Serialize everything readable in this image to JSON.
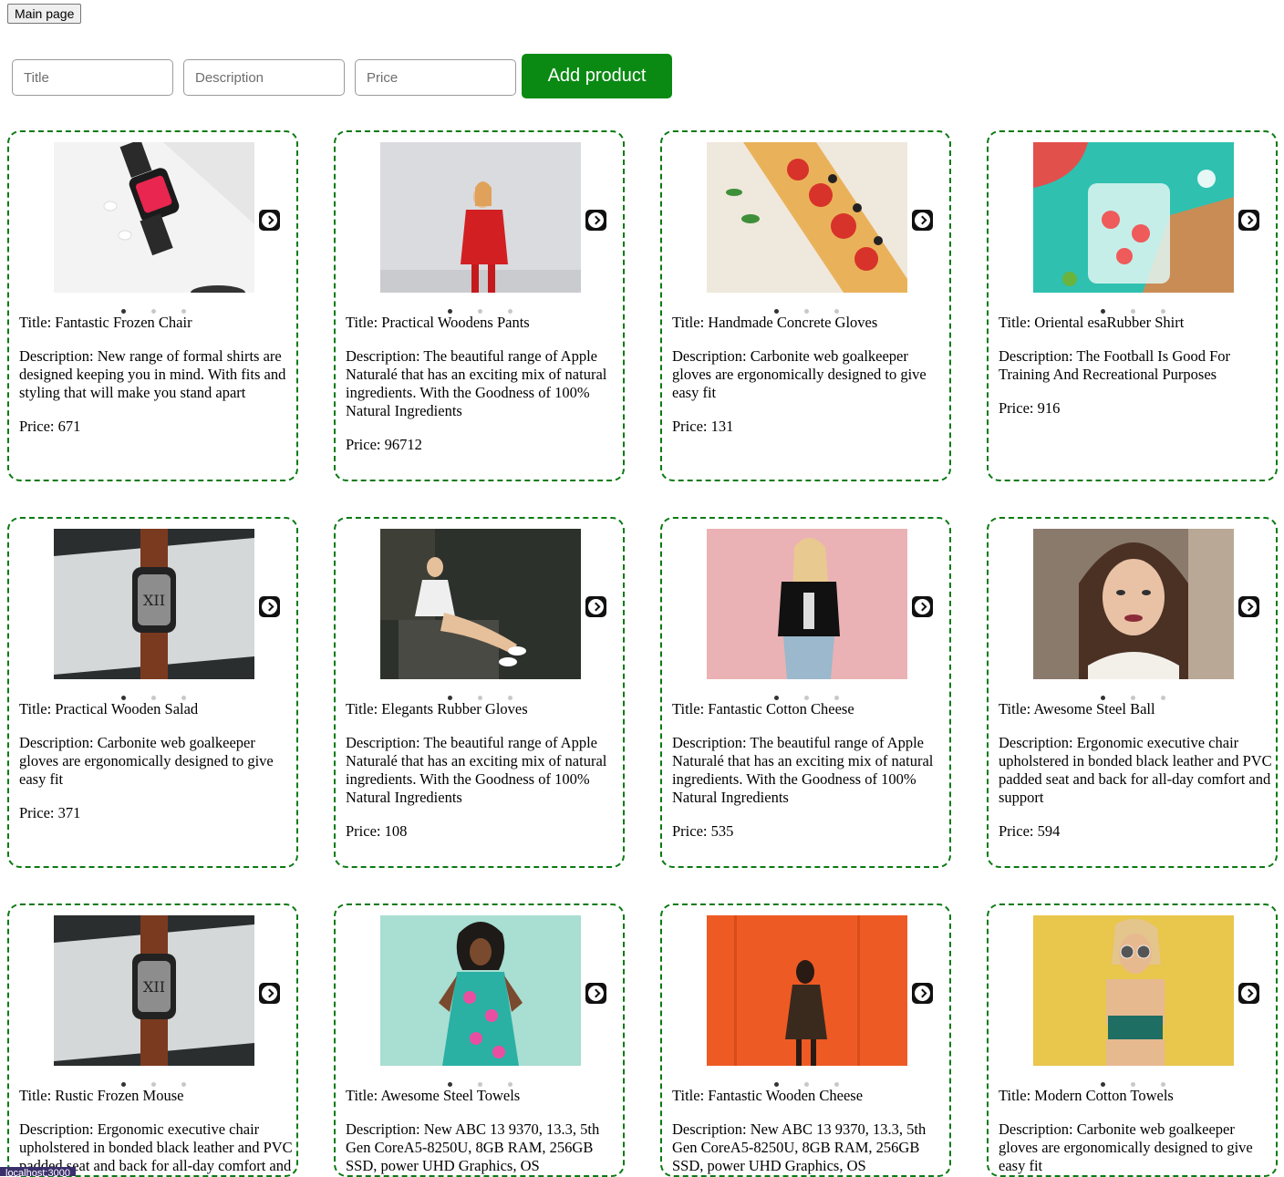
{
  "header": {
    "main_page_label": "Main page"
  },
  "form": {
    "title_placeholder": "Title",
    "description_placeholder": "Description",
    "price_placeholder": "Price",
    "add_label": "Add product"
  },
  "products": [
    {
      "title": "Title: Fantastic Frozen Chair",
      "description": "Description: New range of formal shirts are designed keeping you in mind. With fits and styling that will make you stand apart",
      "price": "Price: 671",
      "image": "smartwatch-flatlay"
    },
    {
      "title": "Title: Practical Woodens Pants",
      "description": "Description: The beautiful range of Apple Naturalé that has an exciting mix of natural ingredients. With the Goodness of 100% Natural Ingredients",
      "price": "Price: 96712",
      "image": "woman-red-sweater"
    },
    {
      "title": "Title: Handmade Concrete Gloves",
      "description": "Description: Carbonite web goalkeeper gloves are ergonomically designed to give easy fit",
      "price": "Price: 131",
      "image": "tomato-tart"
    },
    {
      "title": "Title: Oriental esaRubber Shirt",
      "description": "Description: The Football Is Good For Training And Recreational Purposes",
      "price": "Price: 916",
      "image": "watermelon-drink"
    },
    {
      "title": "Title: Practical Wooden Salad",
      "description": "Description: Carbonite web goalkeeper gloves are ergonomically designed to give easy fit",
      "price": "Price: 371",
      "image": "smartwatch-orange-band"
    },
    {
      "title": "Title: Elegants Rubber Gloves",
      "description": "Description: The beautiful range of Apple Naturalé that has an exciting mix of natural ingredients. With the Goodness of 100% Natural Ingredients",
      "price": "Price: 108",
      "image": "woman-sitting-steps"
    },
    {
      "title": "Title: Fantastic Cotton Cheese",
      "description": "Description: The beautiful range of Apple Naturalé that has an exciting mix of natural ingredients. With the Goodness of 100% Natural Ingredients",
      "price": "Price: 535",
      "image": "woman-pink-wall"
    },
    {
      "title": "Title: Awesome Steel Ball",
      "description": "Description: Ergonomic executive chair upholstered in bonded black leather and PVC padded seat and back for all-day comfort and support",
      "price": "Price: 594",
      "image": "woman-portrait"
    },
    {
      "title": "Title: Rustic Frozen Mouse",
      "description": "Description: Ergonomic executive chair upholstered in bonded black leather and PVC padded seat and back for all-day comfort and support",
      "price": "",
      "image": "smartwatch-orange-band"
    },
    {
      "title": "Title: Awesome Steel Towels",
      "description": "Description: New ABC 13 9370, 13.3, 5th Gen CoreA5-8250U, 8GB RAM, 256GB SSD, power UHD Graphics, OS",
      "price": "",
      "image": "woman-mint-wall"
    },
    {
      "title": "Title: Fantastic Wooden Cheese",
      "description": "Description: New ABC 13 9370, 13.3, 5th Gen CoreA5-8250U, 8GB RAM, 256GB SSD, power UHD Graphics, OS",
      "price": "",
      "image": "woman-orange-wall"
    },
    {
      "title": "Title: Modern Cotton Towels",
      "description": "Description: Carbonite web goalkeeper gloves are ergonomically designed to give easy fit",
      "price": "",
      "image": "woman-yellow-wall"
    }
  ],
  "status_bar": {
    "url": "localhost:3000"
  },
  "colors": {
    "accent": "#0a8a13",
    "card_border": "#0a7a12"
  }
}
